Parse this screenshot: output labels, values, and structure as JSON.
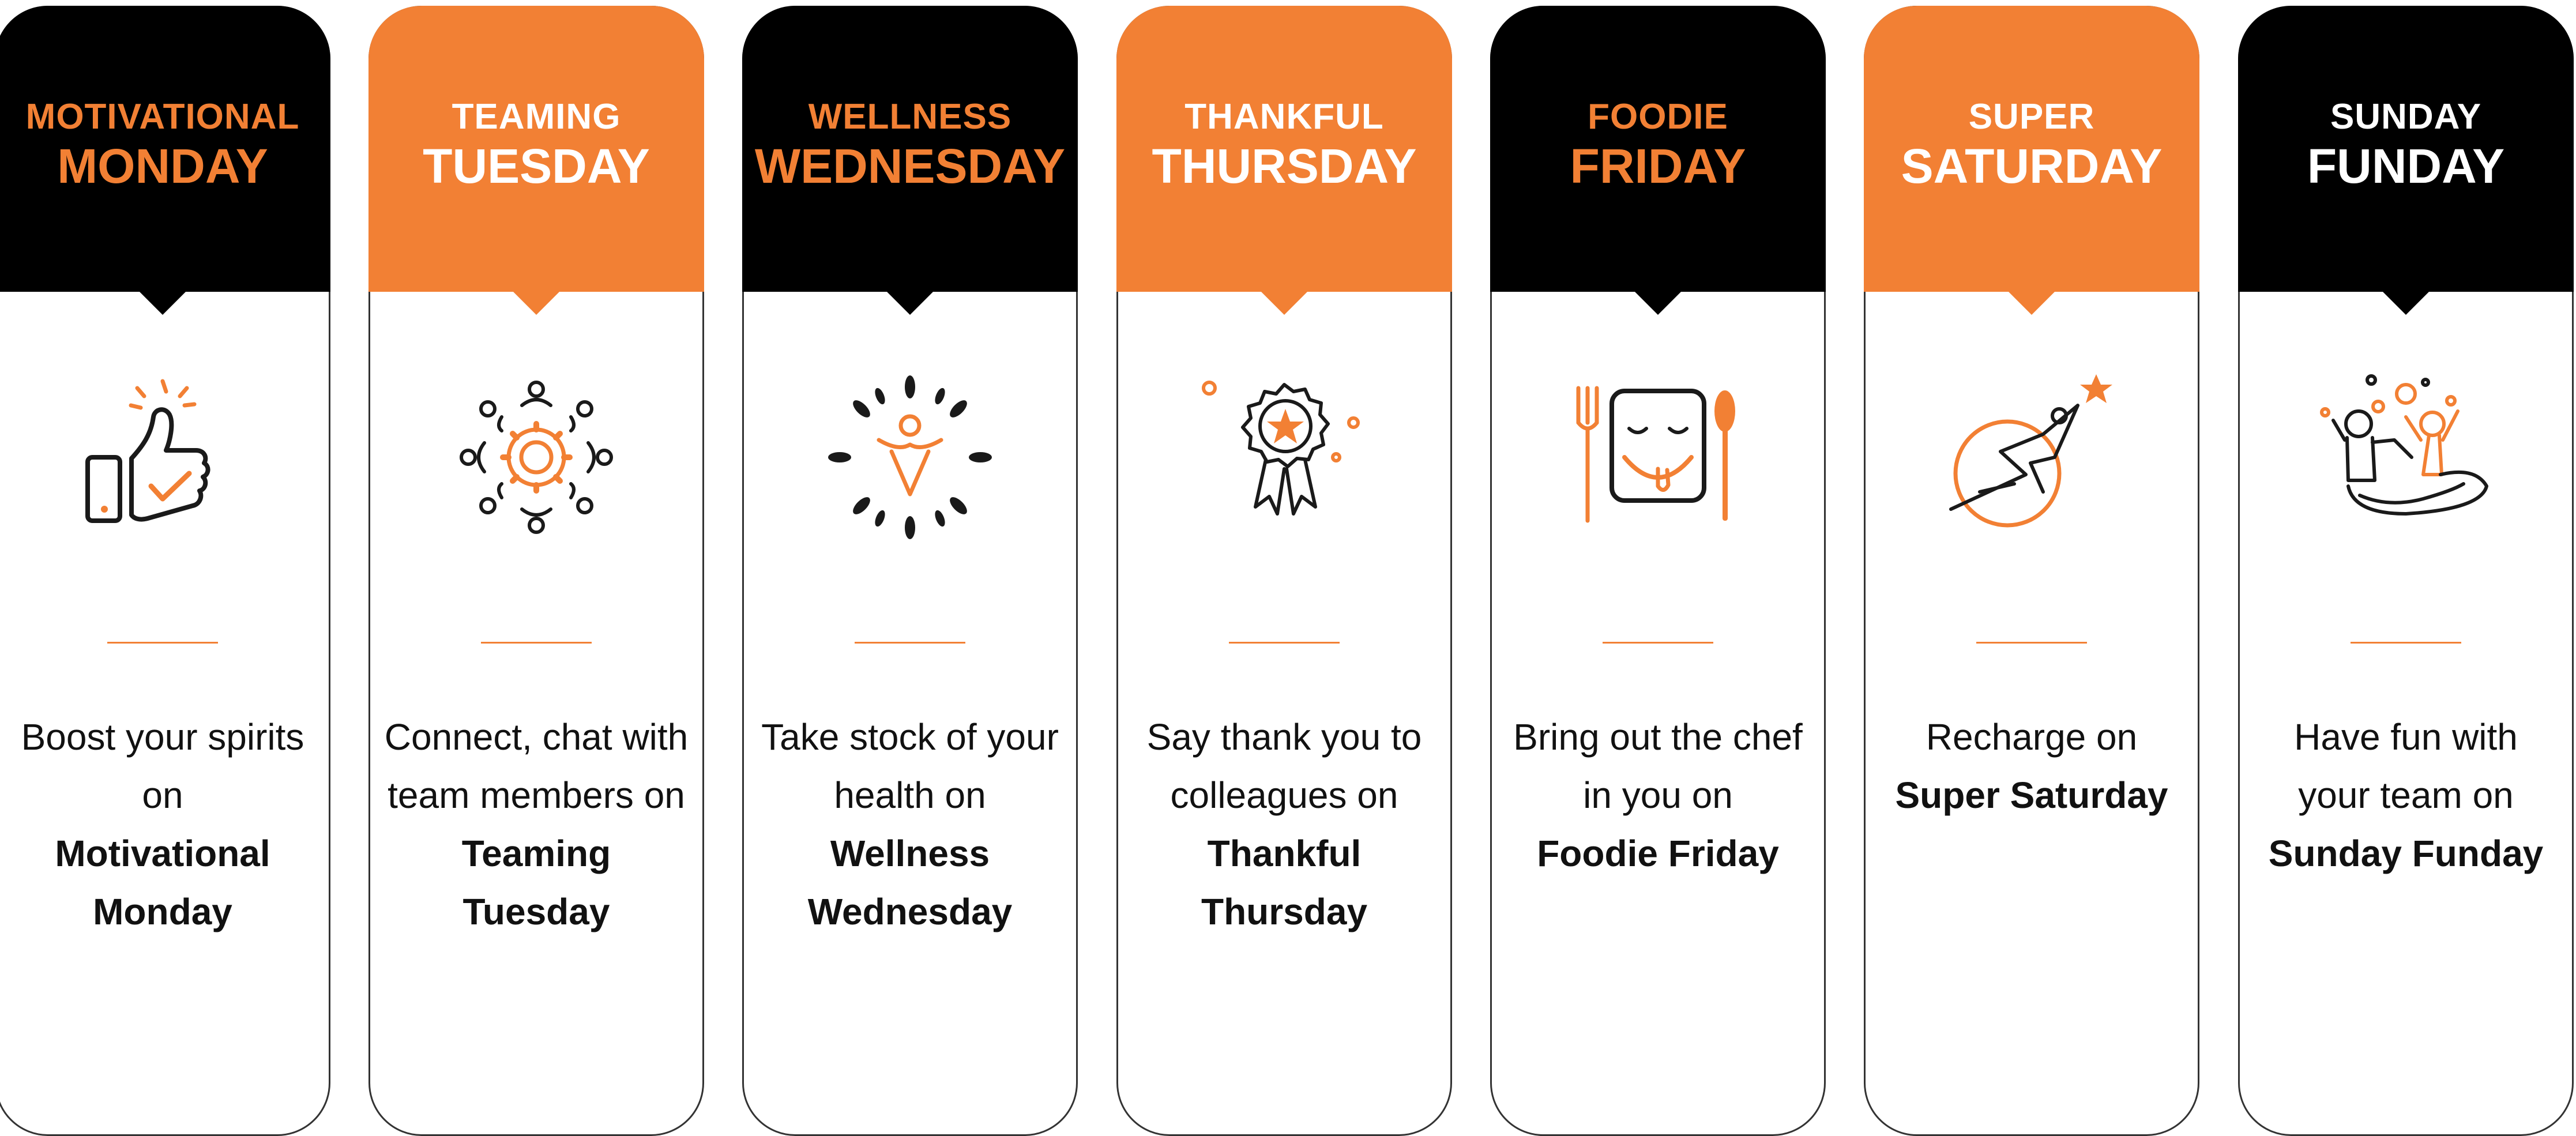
{
  "colors": {
    "orange": "#F28034",
    "black": "#000000",
    "white": "#FFFFFF",
    "text": "#111111",
    "outline": "#333333"
  },
  "cards": [
    {
      "head": {
        "line1": "MOTIVATIONAL",
        "line2": "MONDAY"
      },
      "head_bg": "black",
      "line1_color": "orange",
      "line2_color": "orange",
      "icon": "thumbs-up-icon",
      "desc": {
        "normal": "Boost your spirits on",
        "bold": "Motivational Monday"
      }
    },
    {
      "head": {
        "line1": "TEAMING",
        "line2": "TUESDAY"
      },
      "head_bg": "orange",
      "line1_color": "white",
      "line2_color": "white",
      "icon": "team-gear-icon",
      "desc": {
        "normal": "Connect, chat with team members on",
        "bold": "Teaming Tuesday"
      }
    },
    {
      "head": {
        "line1": "WELLNESS",
        "line2": "WEDNESDAY"
      },
      "head_bg": "black",
      "line1_color": "orange",
      "line2_color": "orange",
      "icon": "wellness-figure-icon",
      "desc": {
        "normal": "Take stock of your health on",
        "bold": "Wellness Wednesday"
      }
    },
    {
      "head": {
        "line1": "THANKFUL",
        "line2": "THURSDAY"
      },
      "head_bg": "orange",
      "line1_color": "white",
      "line2_color": "white",
      "icon": "award-rosette-icon",
      "desc": {
        "normal": "Say thank you to colleagues on",
        "bold": "Thankful Thursday"
      }
    },
    {
      "head": {
        "line1": "FOODIE",
        "line2": "FRIDAY"
      },
      "head_bg": "black",
      "line1_color": "orange",
      "line2_color": "orange",
      "icon": "yummy-face-cutlery-icon",
      "desc": {
        "normal": "Bring out the chef in you on",
        "bold": "Foodie Friday"
      }
    },
    {
      "head": {
        "line1": "SUPER",
        "line2": "SATURDAY"
      },
      "head_bg": "orange",
      "line1_color": "white",
      "line2_color": "white",
      "icon": "superhero-star-icon",
      "desc": {
        "normal": "Recharge on",
        "bold": "Super Saturday"
      }
    },
    {
      "head": {
        "line1": "SUNDAY",
        "line2": "FUNDAY"
      },
      "head_bg": "black",
      "line1_color": "white",
      "line2_color": "white",
      "icon": "celebrating-people-icon",
      "desc": {
        "normal": "Have fun with your team on",
        "bold": "Sunday Funday"
      }
    }
  ]
}
